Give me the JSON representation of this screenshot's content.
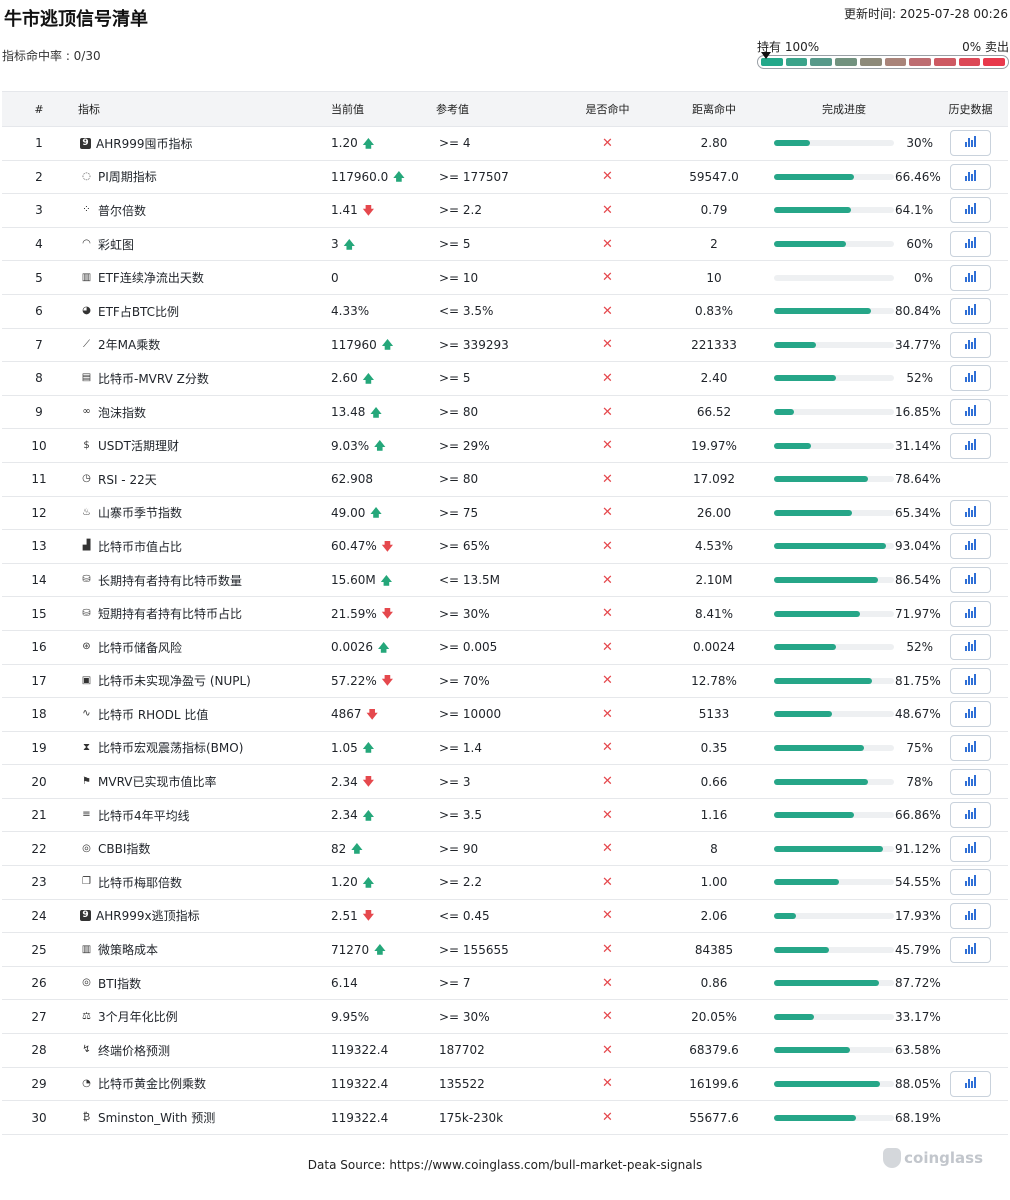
{
  "title": "牛市逃顶信号清单",
  "updated": "更新时间: 2025-07-28 00:26",
  "hit_rate": "指标命中率 : 0/30",
  "gauge": {
    "left_label": "持有 100%",
    "right_label": "0% 卖出",
    "colors": [
      "#23a88a",
      "#3ba38a",
      "#57998a",
      "#72927f",
      "#8d8a7a",
      "#a9847a",
      "#bd6d72",
      "#cd5a63",
      "#dc4857",
      "#e8394c"
    ]
  },
  "headers": {
    "idx": "#",
    "name": "指标",
    "current": "当前值",
    "reference": "参考值",
    "hit": "是否命中",
    "distance": "距离命中",
    "progress": "完成进度",
    "history": "历史数据"
  },
  "rows": [
    {
      "idx": "1",
      "icon": "nine-badge-icon",
      "glyph": "9",
      "box": true,
      "name": "AHR999囤币指标",
      "current": "1.20",
      "trend": "up",
      "reference": ">= 4",
      "hit": "✕",
      "distance": "2.80",
      "progress": 30,
      "progress_label": "30%",
      "history": true
    },
    {
      "idx": "2",
      "icon": "cycle-icon",
      "glyph": "◌",
      "name": "PI周期指标",
      "current": "117960.0",
      "trend": "up",
      "reference": ">= 177507",
      "hit": "✕",
      "distance": "59547.0",
      "progress": 66.46,
      "progress_label": "66.46%",
      "history": true
    },
    {
      "idx": "3",
      "icon": "scatter-icon",
      "glyph": "⁘",
      "name": "普尔倍数",
      "current": "1.41",
      "trend": "down",
      "reference": ">= 2.2",
      "hit": "✕",
      "distance": "0.79",
      "progress": 64.1,
      "progress_label": "64.1%",
      "history": true
    },
    {
      "idx": "4",
      "icon": "rainbow-icon",
      "glyph": "◠",
      "name": "彩虹图",
      "current": "3",
      "trend": "up",
      "reference": ">= 5",
      "hit": "✕",
      "distance": "2",
      "progress": 60,
      "progress_label": "60%",
      "history": true
    },
    {
      "idx": "5",
      "icon": "bar-chart-icon",
      "glyph": "▥",
      "name": "ETF连续净流出天数",
      "current": "0",
      "trend": "",
      "reference": ">= 10",
      "hit": "✕",
      "distance": "10",
      "progress": 0,
      "progress_label": "0%",
      "history": true
    },
    {
      "idx": "6",
      "icon": "pie-chart-icon",
      "glyph": "◕",
      "name": "ETF占BTC比例",
      "current": "4.33%",
      "trend": "",
      "reference": "<= 3.5%",
      "hit": "✕",
      "distance": "0.83%",
      "progress": 80.84,
      "progress_label": "80.84%",
      "history": true
    },
    {
      "idx": "7",
      "icon": "line-chart-icon",
      "glyph": "⟋",
      "name": "2年MA乘数",
      "current": "117960",
      "trend": "up",
      "reference": ">= 339293",
      "hit": "✕",
      "distance": "221333",
      "progress": 34.77,
      "progress_label": "34.77%",
      "history": true
    },
    {
      "idx": "8",
      "icon": "clipboard-chart-icon",
      "glyph": "▤",
      "name": "比特币-MVRV Z分数",
      "current": "2.60",
      "trend": "up",
      "reference": ">= 5",
      "hit": "✕",
      "distance": "2.40",
      "progress": 52,
      "progress_label": "52%",
      "history": true
    },
    {
      "idx": "9",
      "icon": "bubbles-icon",
      "glyph": "∞",
      "name": "泡沫指数",
      "current": "13.48",
      "trend": "up",
      "reference": ">= 80",
      "hit": "✕",
      "distance": "66.52",
      "progress": 16.85,
      "progress_label": "16.85%",
      "history": true
    },
    {
      "idx": "10",
      "icon": "dollar-icon",
      "glyph": "$",
      "name": "USDT活期理财",
      "current": "9.03%",
      "trend": "up",
      "reference": ">= 29%",
      "hit": "✕",
      "distance": "19.97%",
      "progress": 31.14,
      "progress_label": "31.14%",
      "history": true
    },
    {
      "idx": "11",
      "icon": "clock-icon",
      "glyph": "◷",
      "name": "RSI - 22天",
      "current": "62.908",
      "trend": "",
      "reference": ">= 80",
      "hit": "✕",
      "distance": "17.092",
      "progress": 78.64,
      "progress_label": "78.64%",
      "history": false
    },
    {
      "idx": "12",
      "icon": "flame-icon",
      "glyph": "♨",
      "name": "山寨币季节指数",
      "current": "49.00",
      "trend": "up",
      "reference": ">= 75",
      "hit": "✕",
      "distance": "26.00",
      "progress": 65.34,
      "progress_label": "65.34%",
      "history": true
    },
    {
      "idx": "13",
      "icon": "signal-bars-icon",
      "glyph": "▟",
      "name": "比特币市值占比",
      "current": "60.47%",
      "trend": "down",
      "reference": ">= 65%",
      "hit": "✕",
      "distance": "4.53%",
      "progress": 93.04,
      "progress_label": "93.04%",
      "history": true
    },
    {
      "idx": "14",
      "icon": "database-icon",
      "glyph": "⛁",
      "name": "长期持有者持有比特币数量",
      "current": "15.60M",
      "trend": "up",
      "reference": "<= 13.5M",
      "hit": "✕",
      "distance": "2.10M",
      "progress": 86.54,
      "progress_label": "86.54%",
      "history": true
    },
    {
      "idx": "15",
      "icon": "database-icon",
      "glyph": "⛁",
      "name": "短期持有者持有比特币占比",
      "current": "21.59%",
      "trend": "down",
      "reference": ">= 30%",
      "hit": "✕",
      "distance": "8.41%",
      "progress": 71.97,
      "progress_label": "71.97%",
      "history": true
    },
    {
      "idx": "16",
      "icon": "coins-risk-icon",
      "glyph": "⊛",
      "name": "比特币储备风险",
      "current": "0.0026",
      "trend": "up",
      "reference": ">= 0.005",
      "hit": "✕",
      "distance": "0.0024",
      "progress": 52,
      "progress_label": "52%",
      "history": true
    },
    {
      "idx": "17",
      "icon": "vault-icon",
      "glyph": "▣",
      "name": "比特币未实现净盈亏 (NUPL)",
      "current": "57.22%",
      "trend": "down",
      "reference": ">= 70%",
      "hit": "✕",
      "distance": "12.78%",
      "progress": 81.75,
      "progress_label": "81.75%",
      "history": true
    },
    {
      "idx": "18",
      "icon": "pulse-icon",
      "glyph": "∿",
      "name": "比特币 RHODL 比值",
      "current": "4867",
      "trend": "down",
      "reference": ">= 10000",
      "hit": "✕",
      "distance": "5133",
      "progress": 48.67,
      "progress_label": "48.67%",
      "history": true
    },
    {
      "idx": "19",
      "icon": "hourglass-icon",
      "glyph": "⧗",
      "name": "比特币宏观震荡指标(BMO)",
      "current": "1.05",
      "trend": "up",
      "reference": ">= 1.4",
      "hit": "✕",
      "distance": "0.35",
      "progress": 75,
      "progress_label": "75%",
      "history": true
    },
    {
      "idx": "20",
      "icon": "flag-icon",
      "glyph": "⚑",
      "name": "MVRV已实现市值比率",
      "current": "2.34",
      "trend": "down",
      "reference": ">= 3",
      "hit": "✕",
      "distance": "0.66",
      "progress": 78,
      "progress_label": "78%",
      "history": true
    },
    {
      "idx": "21",
      "icon": "lines-icon",
      "glyph": "≡",
      "name": "比特币4年平均线",
      "current": "2.34",
      "trend": "up",
      "reference": ">= 3.5",
      "hit": "✕",
      "distance": "1.16",
      "progress": 66.86,
      "progress_label": "66.86%",
      "history": true
    },
    {
      "idx": "22",
      "icon": "coin-icon",
      "glyph": "◎",
      "name": "CBBI指数",
      "current": "82",
      "trend": "up",
      "reference": ">= 90",
      "hit": "✕",
      "distance": "8",
      "progress": 91.12,
      "progress_label": "91.12%",
      "history": true
    },
    {
      "idx": "23",
      "icon": "layers-icon",
      "glyph": "❐",
      "name": "比特币梅耶倍数",
      "current": "1.20",
      "trend": "up",
      "reference": ">= 2.2",
      "hit": "✕",
      "distance": "1.00",
      "progress": 54.55,
      "progress_label": "54.55%",
      "history": true
    },
    {
      "idx": "24",
      "icon": "nine-badge-icon",
      "glyph": "9",
      "box": true,
      "name": "AHR999x逃顶指标",
      "current": "2.51",
      "trend": "down",
      "reference": "<= 0.45",
      "hit": "✕",
      "distance": "2.06",
      "progress": 17.93,
      "progress_label": "17.93%",
      "history": true
    },
    {
      "idx": "25",
      "icon": "small-bars-icon",
      "glyph": "▥",
      "name": "微策略成本",
      "current": "71270",
      "trend": "up",
      "reference": ">= 155655",
      "hit": "✕",
      "distance": "84385",
      "progress": 45.79,
      "progress_label": "45.79%",
      "history": true
    },
    {
      "idx": "26",
      "icon": "coin-icon",
      "glyph": "◎",
      "name": "BTI指数",
      "current": "6.14",
      "trend": "",
      "reference": ">= 7",
      "hit": "✕",
      "distance": "0.86",
      "progress": 87.72,
      "progress_label": "87.72%",
      "history": false
    },
    {
      "idx": "27",
      "icon": "scale-icon",
      "glyph": "⚖",
      "name": "3个月年化比例",
      "current": "9.95%",
      "trend": "",
      "reference": ">= 30%",
      "hit": "✕",
      "distance": "20.05%",
      "progress": 33.17,
      "progress_label": "33.17%",
      "history": false
    },
    {
      "idx": "28",
      "icon": "trend-icon",
      "glyph": "↯",
      "name": "终端价格预测",
      "current": "119322.4",
      "trend": "",
      "reference": "187702",
      "hit": "✕",
      "distance": "68379.6",
      "progress": 63.58,
      "progress_label": "63.58%",
      "history": false
    },
    {
      "idx": "29",
      "icon": "golden-ratio-icon",
      "glyph": "◔",
      "name": "比特币黄金比例乘数",
      "current": "119322.4",
      "trend": "",
      "reference": "135522",
      "hit": "✕",
      "distance": "16199.6",
      "progress": 88.05,
      "progress_label": "88.05%",
      "history": true
    },
    {
      "idx": "30",
      "icon": "bitcoin-icon",
      "glyph": "₿",
      "name": "Sminston_With 预测",
      "current": "119322.4",
      "trend": "",
      "reference": "175k-230k",
      "hit": "✕",
      "distance": "55677.6",
      "progress": 68.19,
      "progress_label": "68.19%",
      "history": false
    }
  ],
  "footer": "Data Source: https://www.coinglass.com/bull-market-peak-signals",
  "brand": "coinglass"
}
